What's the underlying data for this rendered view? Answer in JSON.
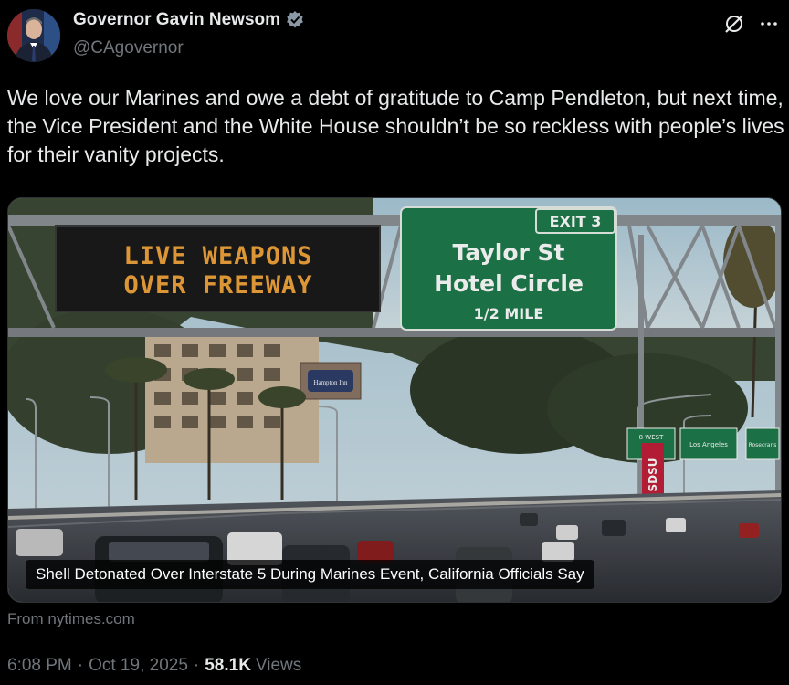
{
  "author": {
    "display_name": "Governor Gavin Newsom",
    "handle": "@CAgovernor",
    "avatar_icon": "person-avatar",
    "verified_icon": "verified-badge-icon",
    "verified_color": "#8b98a5"
  },
  "actions": {
    "grok_icon": "grok-icon",
    "more_icon": "more-dots-icon"
  },
  "tweet": {
    "text": "We love our Marines and owe a debt of gratitude to Camp Pendleton, but next time, the Vice President and the White House shouldn’t be so reckless with people’s lives for their vanity projects."
  },
  "link_card": {
    "title": "Shell Detonated Over Interstate 5 During Marines Event, California Officials Say",
    "source": "From nytimes.com",
    "image": {
      "led_sign_line1": "LIVE WEAPONS",
      "led_sign_line2": "OVER FREEWAY",
      "exit_label": "EXIT 3",
      "green_sign_line1": "Taylor St",
      "green_sign_line2": "Hotel Circle",
      "green_sign_line3": "1/2 MILE",
      "hotel_sign": "Hampton Inn",
      "banner_text": "SDSU",
      "small_sign_1": "8 WEST",
      "small_sign_2": "Los Angeles",
      "small_sign_3": "Rosecrans"
    }
  },
  "meta": {
    "time": "6:08 PM",
    "separator": "·",
    "date": "Oct 19, 2025",
    "views_count": "58.1K",
    "views_label": "Views"
  },
  "colors": {
    "background": "#000000",
    "text_primary": "#e7e9ea",
    "text_secondary": "#71767b",
    "sign_green": "#1f7a4c",
    "led_orange": "#f0a33a"
  }
}
